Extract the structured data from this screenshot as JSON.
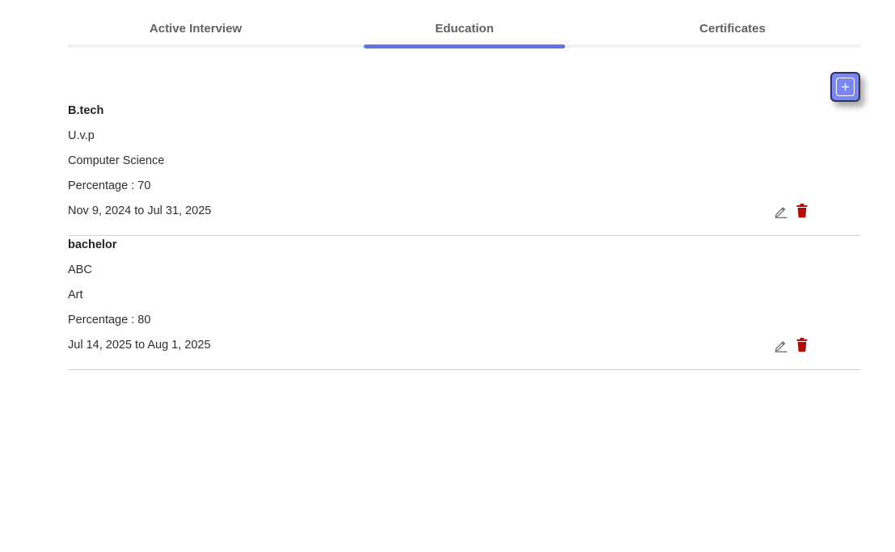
{
  "tabs": [
    {
      "label": "Active Interview",
      "active": false
    },
    {
      "label": "Education",
      "active": true
    },
    {
      "label": "Certificates",
      "active": false
    }
  ],
  "colors": {
    "accent": "#6470e8",
    "delete": "#b00d0d",
    "add_button": "#7b86f0"
  },
  "add_button": {
    "icon": "plus-icon"
  },
  "education": [
    {
      "degree": "B.tech",
      "institution": "U.v.p",
      "field": "Computer Science",
      "percentage": "Percentage : 70",
      "dates": "Nov 9, 2024 to Jul 31, 2025",
      "edit_icon": "pencil-icon",
      "delete_icon": "trash-icon"
    },
    {
      "degree": "bachelor",
      "institution": "ABC",
      "field": "Art",
      "percentage": "Percentage : 80",
      "dates": "Jul 14, 2025 to Aug 1, 2025",
      "edit_icon": "pencil-icon",
      "delete_icon": "trash-icon"
    }
  ]
}
